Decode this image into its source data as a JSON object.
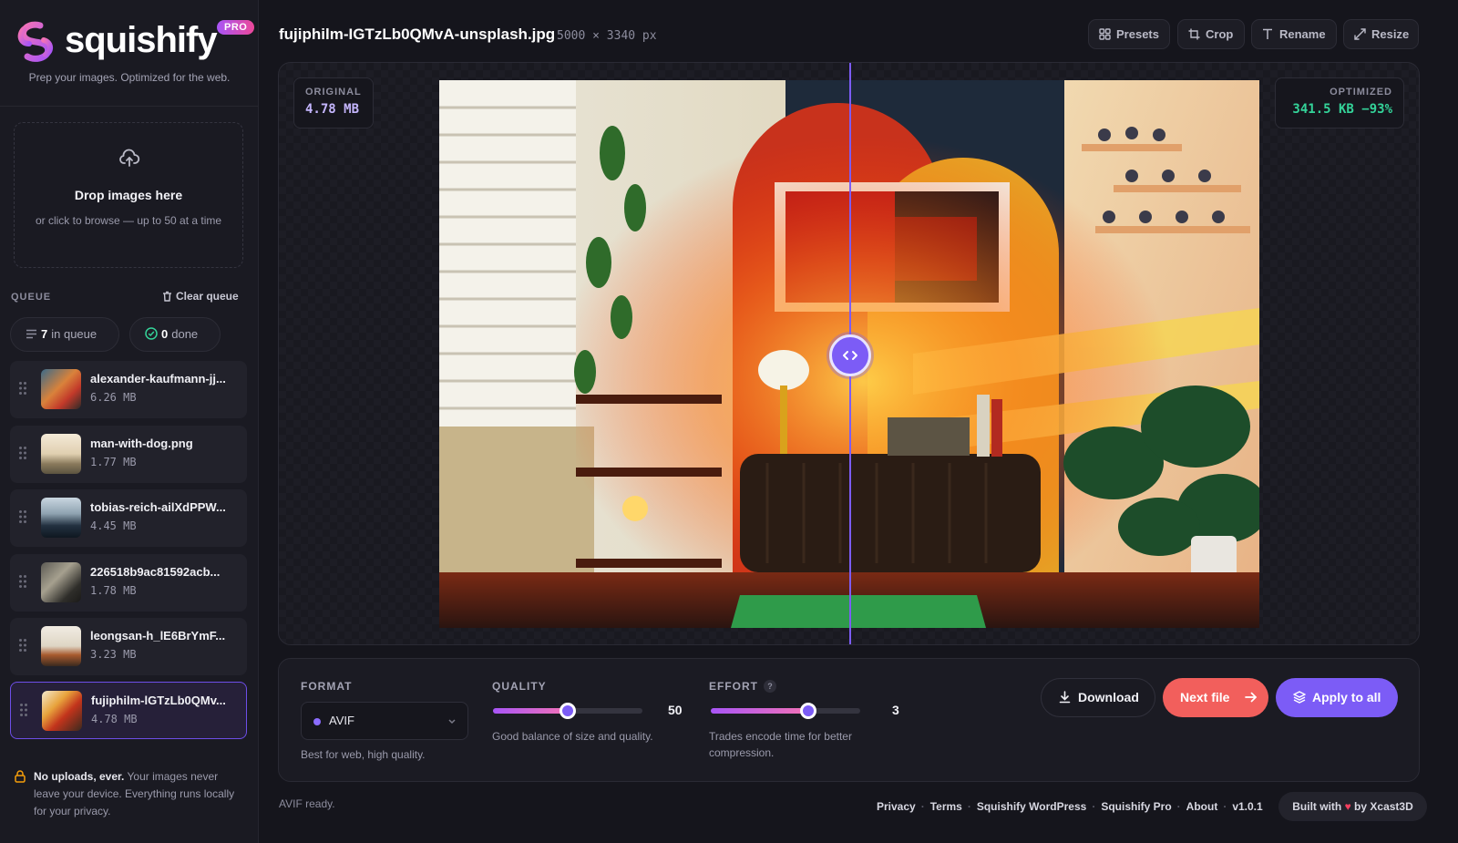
{
  "brand": {
    "name": "squishify",
    "badge": "PRO",
    "tagline": "Prep your images. Optimized for the web."
  },
  "dropzone": {
    "title": "Drop images here",
    "subtitle": "or click to browse — up to 50 at a time"
  },
  "queue": {
    "label": "QUEUE",
    "clear_label": "Clear queue",
    "in_queue_count": "7",
    "in_queue_label": "in queue",
    "done_count": "0",
    "done_label": "done",
    "items": [
      {
        "name": "alexander-kaufmann-jj...",
        "size": "6.26 MB"
      },
      {
        "name": "man-with-dog.png",
        "size": "1.77 MB"
      },
      {
        "name": "tobias-reich-ailXdPPW...",
        "size": "4.45 MB"
      },
      {
        "name": "226518b9ac81592acb...",
        "size": "1.78 MB"
      },
      {
        "name": "leongsan-h_lE6BrYmF...",
        "size": "3.23 MB"
      },
      {
        "name": "fujiphilm-lGTzLb0QMv...",
        "size": "4.78 MB",
        "active": true
      }
    ]
  },
  "privacy": {
    "bold": "No uploads, ever.",
    "text": " Your images never leave your device. Everything runs locally for your privacy."
  },
  "header": {
    "file_name": "fujiphilm-IGTzLb0QMvA-unsplash.jpg",
    "dimensions": "5000 × 3340 px",
    "tools": {
      "presets": "Presets",
      "crop": "Crop",
      "rename": "Rename",
      "resize": "Resize"
    }
  },
  "preview": {
    "original_label": "ORIGINAL",
    "original_size": "4.78 MB",
    "optimized_label": "OPTIMIZED",
    "optimized_size": "341.5 KB −93%",
    "split_fraction": 0.5
  },
  "controls": {
    "format": {
      "label": "FORMAT",
      "value": "AVIF",
      "hint": "Best for web, high quality."
    },
    "quality": {
      "label": "QUALITY",
      "value": "50",
      "level": 0.5,
      "hint": "Good balance of size and quality."
    },
    "effort": {
      "label": "EFFORT",
      "help": "?",
      "value": "3",
      "level": 0.65,
      "hint": "Trades encode time for better compression."
    },
    "download_label": "Download",
    "next_label": "Next file",
    "apply_label": "Apply to all"
  },
  "footer": {
    "status": "AVIF ready.",
    "links": [
      "Privacy",
      "Terms",
      "Squishify WordPress",
      "Squishify Pro",
      "About"
    ],
    "version": "v1.0.1",
    "built_prefix": "Built with",
    "built_suffix": "by Xcast3D"
  },
  "colors": {
    "accent": "#7c5cf6",
    "next_button": "#f25f5c",
    "optimized_text": "#34d399",
    "background": "#15151c"
  }
}
